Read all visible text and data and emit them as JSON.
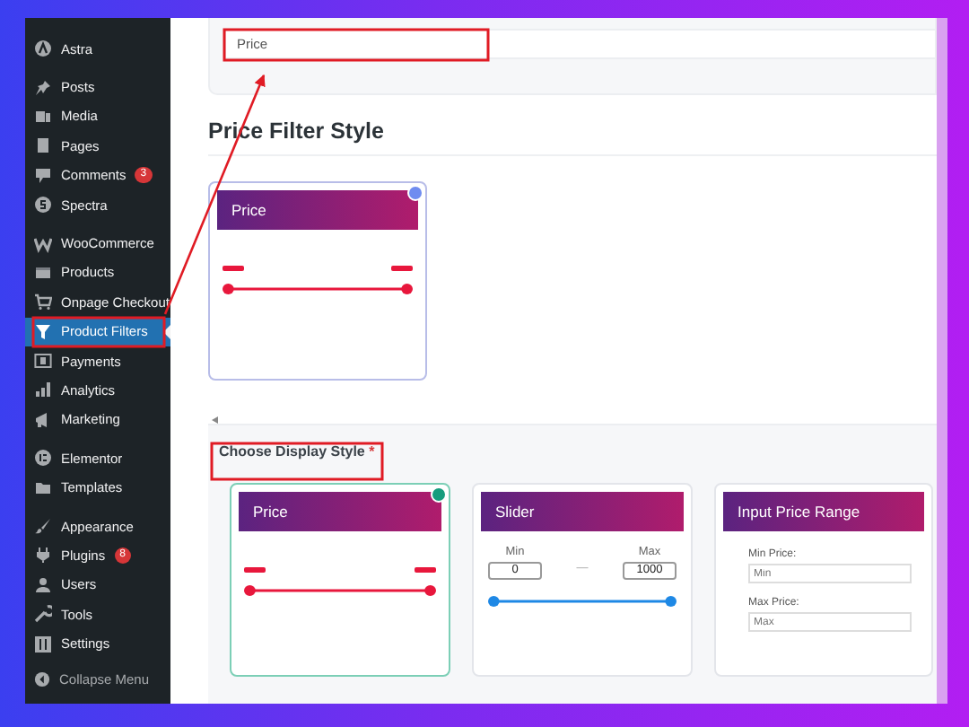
{
  "sidebar": {
    "groups": [
      {
        "items": [
          {
            "label": "Astra",
            "selected": false
          }
        ]
      },
      {
        "items": [
          {
            "label": "Posts",
            "selected": false
          },
          {
            "label": "Media",
            "selected": false
          },
          {
            "label": "Pages",
            "selected": false
          },
          {
            "label": "Comments",
            "selected": false,
            "badge": "3"
          },
          {
            "label": "Spectra",
            "selected": false
          }
        ]
      },
      {
        "items": [
          {
            "label": "WooCommerce",
            "selected": false
          },
          {
            "label": "Products",
            "selected": false
          },
          {
            "label": "Onpage Checkout",
            "selected": false
          },
          {
            "label": "Product Filters",
            "selected": true
          },
          {
            "label": "Payments",
            "selected": false
          },
          {
            "label": "Analytics",
            "selected": false
          },
          {
            "label": "Marketing",
            "selected": false
          }
        ]
      },
      {
        "items": [
          {
            "label": "Elementor",
            "selected": false
          },
          {
            "label": "Templates",
            "selected": false
          }
        ]
      },
      {
        "items": [
          {
            "label": "Appearance",
            "selected": false
          },
          {
            "label": "Plugins",
            "selected": false,
            "badge": "8"
          },
          {
            "label": "Users",
            "selected": false
          },
          {
            "label": "Tools",
            "selected": false
          },
          {
            "label": "Settings",
            "selected": false
          }
        ]
      }
    ],
    "collapse": "Collapse Menu"
  },
  "filter_name_field": {
    "value": "Price"
  },
  "price_filter_style": {
    "heading": "Price Filter Style",
    "preview": {
      "kind": "range",
      "title": "Price",
      "selected": true
    }
  },
  "display_style": {
    "label": "Choose Display Style",
    "required_mark": "*",
    "options": [
      {
        "kind": "range",
        "title": "Price",
        "selected": true
      },
      {
        "kind": "slider",
        "title": "Slider",
        "selected": false,
        "min_label": "Min",
        "max_label": "Max",
        "min_value": "0",
        "max_value": "1000",
        "separator": "—"
      },
      {
        "kind": "inputs",
        "title": "Input Price Range",
        "selected": false,
        "min_label": "Min Price:",
        "min_placeholder": "Min",
        "max_label": "Max Price:",
        "max_placeholder": "Max"
      }
    ]
  }
}
